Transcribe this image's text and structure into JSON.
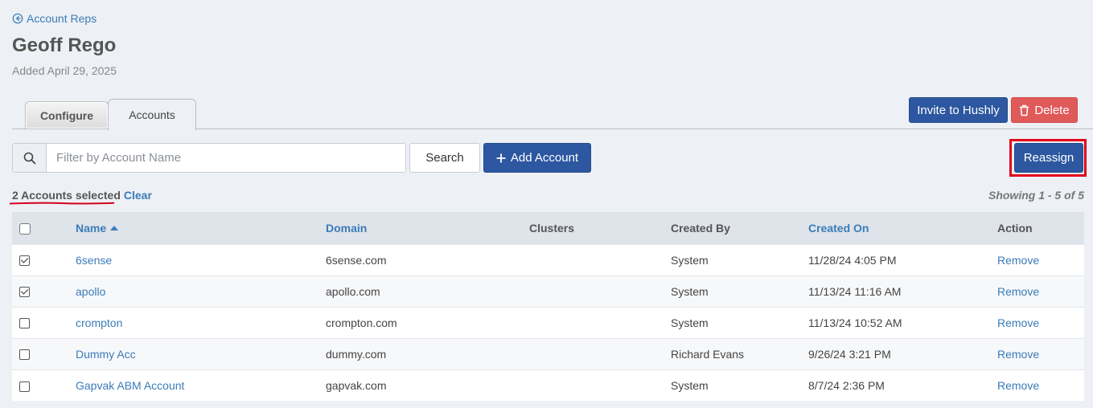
{
  "nav": {
    "back_label": "Account Reps"
  },
  "header": {
    "title": "Geoff Rego",
    "subtitle": "Added April 29, 2025"
  },
  "tabs": [
    {
      "label": "Configure",
      "active": false
    },
    {
      "label": "Accounts",
      "active": true
    }
  ],
  "actions": {
    "invite_label": "Invite to Hushly",
    "delete_label": "Delete"
  },
  "toolbar": {
    "search_placeholder": "Filter by Account Name",
    "search_value": "",
    "search_button": "Search",
    "add_account": "Add Account",
    "reassign": "Reassign"
  },
  "selection": {
    "text": "2 Accounts selected",
    "clear": "Clear"
  },
  "showing": "Showing 1 - 5 of 5",
  "table": {
    "columns": {
      "name": "Name",
      "domain": "Domain",
      "clusters": "Clusters",
      "created_by": "Created By",
      "created_on": "Created On",
      "action": "Action"
    },
    "rows": [
      {
        "checked": true,
        "name": "6sense",
        "domain": "6sense.com",
        "clusters": "",
        "created_by": "System",
        "created_on": "11/28/24 4:05 PM",
        "action": "Remove"
      },
      {
        "checked": true,
        "name": "apollo",
        "domain": "apollo.com",
        "clusters": "",
        "created_by": "System",
        "created_on": "11/13/24 11:16 AM",
        "action": "Remove"
      },
      {
        "checked": false,
        "name": "crompton",
        "domain": "crompton.com",
        "clusters": "",
        "created_by": "System",
        "created_on": "11/13/24 10:52 AM",
        "action": "Remove"
      },
      {
        "checked": false,
        "name": "Dummy Acc",
        "domain": "dummy.com",
        "clusters": "",
        "created_by": "Richard Evans",
        "created_on": "9/26/24 3:21 PM",
        "action": "Remove"
      },
      {
        "checked": false,
        "name": "Gapvak ABM Account",
        "domain": "gapvak.com",
        "clusters": "",
        "created_by": "System",
        "created_on": "8/7/24 2:36 PM",
        "action": "Remove"
      }
    ]
  },
  "colors": {
    "link": "#3a7cb8",
    "primary": "#2d57a0",
    "danger": "#e05a5a",
    "highlight": "#e4001b"
  }
}
